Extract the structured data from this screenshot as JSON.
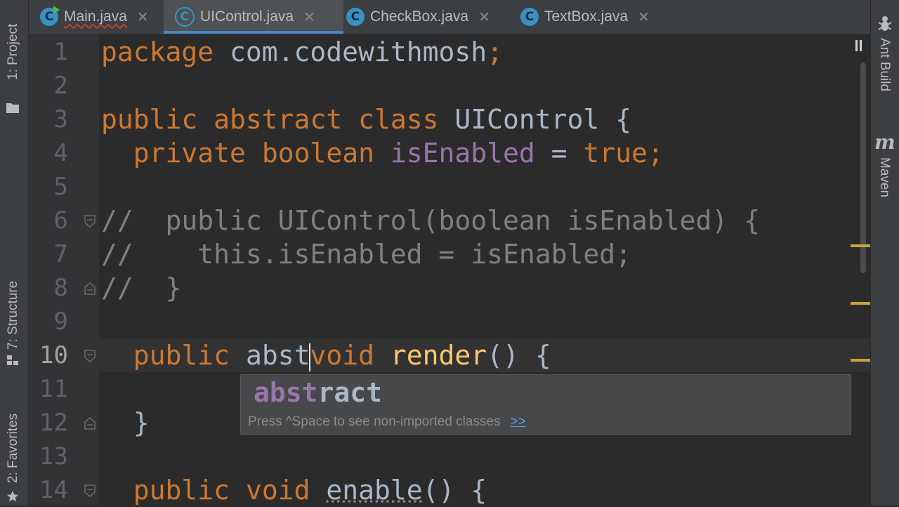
{
  "left_toolbar": {
    "project_label": "1: Project",
    "structure_label": "7: Structure",
    "favorites_label": "2: Favorites"
  },
  "right_toolbar": {
    "ant_label": "Ant Build",
    "maven_label": "Maven",
    "maven_glyph": "m"
  },
  "tabs": [
    {
      "label": "Main.java",
      "icon": "class-run-icon"
    },
    {
      "label": "UIControl.java",
      "icon": "abstract-class-icon",
      "active": true
    },
    {
      "label": "CheckBox.java",
      "icon": "class-icon"
    },
    {
      "label": "TextBox.java",
      "icon": "class-icon"
    }
  ],
  "tab_close_glyph": "✕",
  "tab_icon_letter": "C",
  "editor": {
    "line_numbers": [
      "1",
      "2",
      "3",
      "4",
      "5",
      "6",
      "7",
      "8",
      "9",
      "10",
      "11",
      "12",
      "13",
      "14"
    ],
    "current_line": "10",
    "lines": {
      "l1": {
        "kw": "package",
        "rest": " com.codewithmosh",
        "semi": ";"
      },
      "l3": {
        "kw1": "public",
        "kw2": "abstract",
        "kw3": "class",
        "name": "UIControl",
        "brace": " {"
      },
      "l4": {
        "kw1": "private",
        "kw2": "boolean",
        "field": "isEnabled",
        "eq": " = ",
        "val": "true",
        "semi": ";"
      },
      "l6": "//  public UIControl(boolean isEnabled) {",
      "l7": "//    this.isEnabled = isEnabled;",
      "l8": "//  }",
      "l10": {
        "kw1": "public",
        "typed": "abst",
        "kw2": "void",
        "fn": "render",
        "rest": "() {"
      },
      "l12": "}",
      "l14": {
        "kw1": "public",
        "kw2": "void",
        "fn": "enable",
        "rest": "() {"
      }
    }
  },
  "completion": {
    "match": "abst",
    "remainder": "ract",
    "hint": "Press ^Space to see non-imported classes",
    "hint_link": ">>"
  },
  "colors": {
    "keyword": "#cc7832",
    "field": "#9876aa",
    "method": "#ffc66d",
    "comment": "#808080",
    "text": "#a9b7c6",
    "background": "#2b2b2b",
    "tab_accent": "#4a88c7"
  }
}
